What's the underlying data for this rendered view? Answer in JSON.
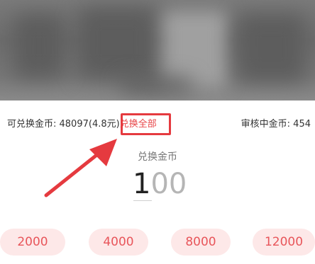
{
  "balance": {
    "label": "可兑换金币: 48097(4.8元)",
    "exchange_all": "兑换全部"
  },
  "pending": {
    "label": "审核中金币: 454"
  },
  "amount": {
    "title": "兑换金币",
    "typed": "1",
    "placeholder_rest": "00"
  },
  "quick_amounts": [
    "2000",
    "4000",
    "8000",
    "12000"
  ],
  "colors": {
    "accent": "#e8474a",
    "chip_bg": "#fde8e8",
    "annotation": "#e53a3f"
  }
}
